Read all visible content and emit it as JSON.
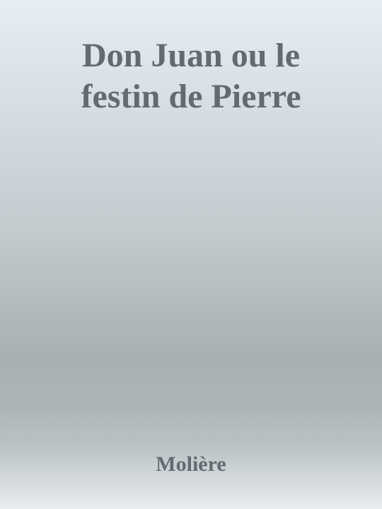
{
  "cover": {
    "title_lines": [
      "Don Juan ou le",
      "festin de Pierre"
    ],
    "author": "Molière"
  }
}
